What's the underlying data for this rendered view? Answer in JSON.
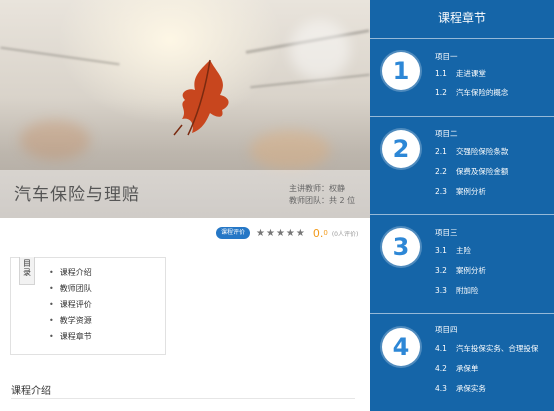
{
  "course": {
    "title": "汽车保险与理赔",
    "teacher_line": "主讲教师：权静",
    "team_line": "教师团队：共 2 位"
  },
  "rating": {
    "button_label": "课程评价",
    "stars": "★★★★★",
    "score_main": "0.",
    "score_decimal": "0",
    "count_text": "(0人评价)"
  },
  "directory": {
    "tag_chars": [
      "目",
      "录"
    ],
    "items": [
      "课程介绍",
      "教师团队",
      "课程评价",
      "教学资源",
      "课程章节"
    ]
  },
  "section": {
    "title": "课程介绍"
  },
  "chapters_panel": {
    "title": "课程章节",
    "chapters": [
      {
        "number": "1",
        "name": "项目一",
        "lessons": [
          {
            "index": "1.1",
            "title": "走进课堂"
          },
          {
            "index": "1.2",
            "title": "汽车保险的概念"
          }
        ]
      },
      {
        "number": "2",
        "name": "项目二",
        "lessons": [
          {
            "index": "2.1",
            "title": "交强险保险条款"
          },
          {
            "index": "2.2",
            "title": "保费及保险金额"
          },
          {
            "index": "2.3",
            "title": "案例分析"
          }
        ]
      },
      {
        "number": "3",
        "name": "项目三",
        "lessons": [
          {
            "index": "3.1",
            "title": "主险"
          },
          {
            "index": "3.2",
            "title": "案例分析"
          },
          {
            "index": "3.3",
            "title": "附加险"
          }
        ]
      },
      {
        "number": "4",
        "name": "项目四",
        "lessons": [
          {
            "index": "4.1",
            "title": "汽车投保实务、合理投保"
          },
          {
            "index": "4.2",
            "title": "承保单"
          },
          {
            "index": "4.3",
            "title": "承保实务"
          }
        ]
      }
    ]
  },
  "colors": {
    "panel_blue": "#1565a8",
    "accent_orange": "#f29a1b",
    "button_blue": "#2577c6"
  }
}
